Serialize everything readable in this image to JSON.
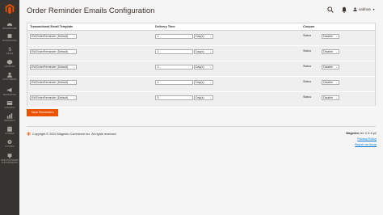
{
  "page": {
    "title": "Order Reminder Emails Configuration"
  },
  "header": {
    "user_name": "sabhas"
  },
  "sidebar": {
    "items": [
      {
        "label": "DASHBOARD",
        "icon": "dashboard-icon"
      },
      {
        "label": "EXTENSIONS",
        "icon": "extensions-icon"
      },
      {
        "label": "SALES",
        "icon": "dollar-icon"
      },
      {
        "label": "CATALOG",
        "icon": "cube-icon"
      },
      {
        "label": "CUSTOMERS",
        "icon": "customers-icon"
      },
      {
        "label": "MARKETING",
        "icon": "megaphone-icon"
      },
      {
        "label": "CONTENT",
        "icon": "content-icon"
      },
      {
        "label": "REPORTS",
        "icon": "reports-icon"
      },
      {
        "label": "STORES",
        "icon": "stores-icon"
      },
      {
        "label": "SYSTEM",
        "icon": "gear-icon"
      },
      {
        "label": "FIND PARTNERS & EXTENSIONS",
        "icon": "partners-icon"
      }
    ]
  },
  "table": {
    "headers": {
      "template": "Transactional Email Template",
      "delivery": "Delivery Time",
      "coupon": "Coupon"
    },
    "rows": [
      {
        "template": "EWOrderReminder (Default)",
        "delivery_value": "1",
        "unit": "Day(s)",
        "status_label": "Status",
        "status": "Disable"
      },
      {
        "template": "EWOrderReminder (Default)",
        "delivery_value": "2",
        "unit": "Day(s)",
        "status_label": "Status",
        "status": "Disable"
      },
      {
        "template": "EWOrderReminder (Default)",
        "delivery_value": "3",
        "unit": "Day(s)",
        "status_label": "Status",
        "status": "Disable"
      },
      {
        "template": "EWOrderReminder (Default)",
        "delivery_value": "4",
        "unit": "Day(s)",
        "status_label": "Status",
        "status": "Disable"
      },
      {
        "template": "EWOrderReminder (Default)",
        "delivery_value": "5",
        "unit": "Day(s)",
        "status_label": "Status",
        "status": "Disable"
      }
    ]
  },
  "actions": {
    "save_label": "Save Reminders"
  },
  "footer": {
    "copyright": "Copyright © 2022 Magento Commerce Inc. All rights reserved.",
    "product": "Magento",
    "version": "ver. 2.4.3-p2",
    "privacy": "Privacy Policy",
    "report": "Report an Issue"
  },
  "colors": {
    "sidebar": "#373330",
    "accent": "#eb5202",
    "link": "#007bdb"
  }
}
